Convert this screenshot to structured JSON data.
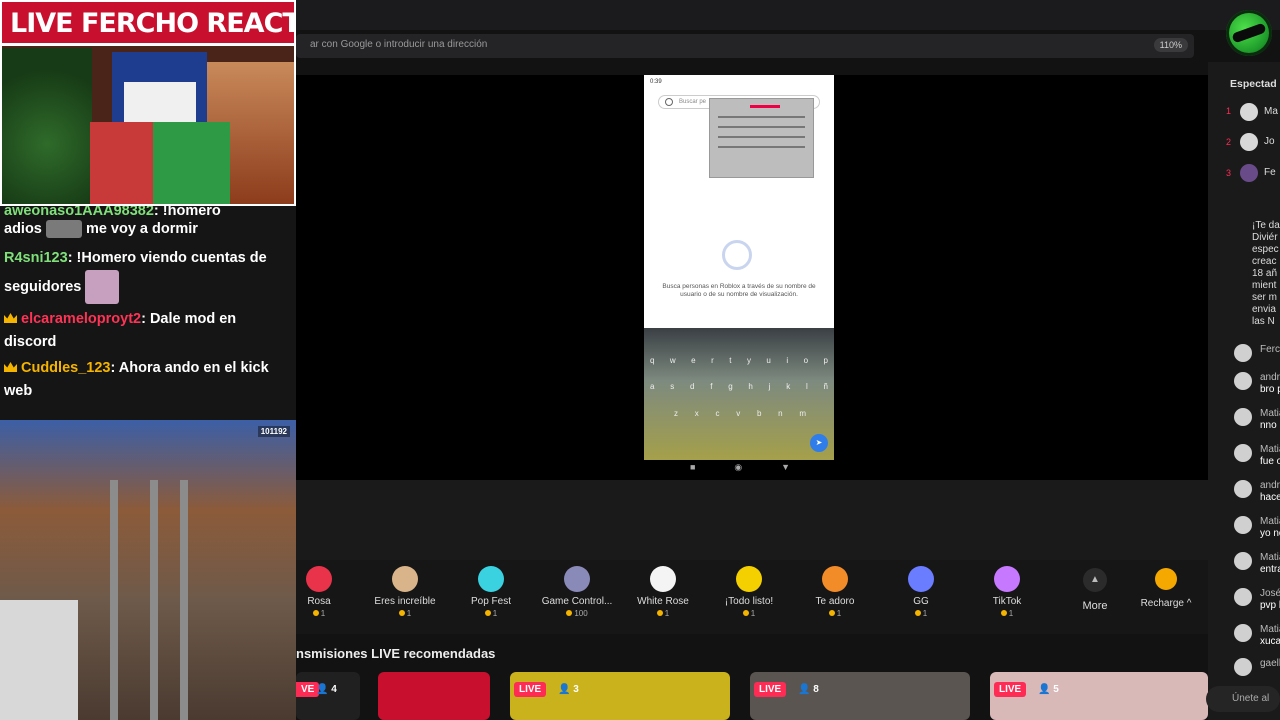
{
  "browser": {
    "url_placeholder": "ar con Google o introducir una dirección",
    "zoom": "110%"
  },
  "overlay": {
    "banner": "LIVE FERCHO REACTION"
  },
  "chat_overlay": {
    "messages": [
      {
        "user": "aweonaso1AAA98382",
        "text": " !homero"
      },
      {
        "user": "",
        "text": "adios",
        "text_after": "me voy a dormir"
      },
      {
        "user": "R4sni123",
        "text": ": !Homero viendo cuentas de seguidores"
      },
      {
        "user": "elcarameloproyt2",
        "text": ": Dale mod en discord"
      },
      {
        "user": "Cuddles_123",
        "text": ": Ahora ando en el kick web"
      }
    ],
    "colors": {
      "user1": "#7fe07a",
      "user2": "#7fe07a",
      "user3": "#ff3355",
      "user4": "#f5b400"
    }
  },
  "game": {
    "score": "101192"
  },
  "phone": {
    "time": "0:39",
    "search_placeholder": "Buscar pe",
    "hint": "Busca personas en Roblox a través de su nombre de usuario o de su nombre de visualización.",
    "keyboard_row1": [
      "q",
      "w",
      "e",
      "r",
      "t",
      "y",
      "u",
      "i",
      "o",
      "p"
    ],
    "keyboard_row2": [
      "a",
      "s",
      "d",
      "f",
      "g",
      "h",
      "j",
      "k",
      "l",
      "ñ"
    ],
    "keyboard_row3": [
      "z",
      "x",
      "c",
      "v",
      "b",
      "n",
      "m"
    ]
  },
  "gifts": [
    {
      "name": "Rosa",
      "cost": "1",
      "color": "#e8334a"
    },
    {
      "name": "Eres increíble",
      "cost": "1",
      "color": "#d9b48a"
    },
    {
      "name": "Pop Fest",
      "cost": "1",
      "color": "#3ad1e0"
    },
    {
      "name": "Game Control...",
      "cost": "100",
      "color": "#8a8ab8"
    },
    {
      "name": "White Rose",
      "cost": "1",
      "color": "#f4f4f4"
    },
    {
      "name": "¡Todo listo!",
      "cost": "1",
      "color": "#f5d000"
    },
    {
      "name": "Te adoro",
      "cost": "1",
      "color": "#f28c28"
    },
    {
      "name": "GG",
      "cost": "1",
      "color": "#6a7cff"
    },
    {
      "name": "TikTok",
      "cost": "1",
      "color": "#c678ff"
    }
  ],
  "more_label": "More",
  "recharge_label": "Recharge",
  "recommended": {
    "title": "nsmisiones LIVE recomendadas",
    "cards": [
      {
        "live": "VE",
        "viewers": "4"
      },
      {
        "live": "LIVE",
        "viewers": "3"
      },
      {
        "live": "LIVE",
        "viewers": "8"
      },
      {
        "live": "LIVE",
        "viewers": "5"
      }
    ]
  },
  "right_panel": {
    "title": "Espectad",
    "ranking": [
      {
        "rank": "1",
        "name": "Ma"
      },
      {
        "rank": "2",
        "name": "Jo"
      },
      {
        "rank": "3",
        "name": "Fe"
      }
    ],
    "pinned": [
      "¡Te da",
      "Diviér",
      "espec",
      "creac",
      "18 añ",
      "mient",
      "ser m",
      "envia",
      "las N"
    ],
    "comments": [
      {
        "name": "Ferch",
        "text": ""
      },
      {
        "name": "andre",
        "text": "bro p"
      },
      {
        "name": "Matia",
        "text": "nno"
      },
      {
        "name": "Matia",
        "text": "fue o"
      },
      {
        "name": "andre",
        "text": "haces"
      },
      {
        "name": "Matia",
        "text": "yo no"
      },
      {
        "name": "Matia",
        "text": "entra"
      },
      {
        "name": "José",
        "text": "pvp b"
      },
      {
        "name": "Matia",
        "text": "xuca"
      },
      {
        "name": "gaell",
        "text": ""
      }
    ],
    "join_label": "Únete al"
  }
}
